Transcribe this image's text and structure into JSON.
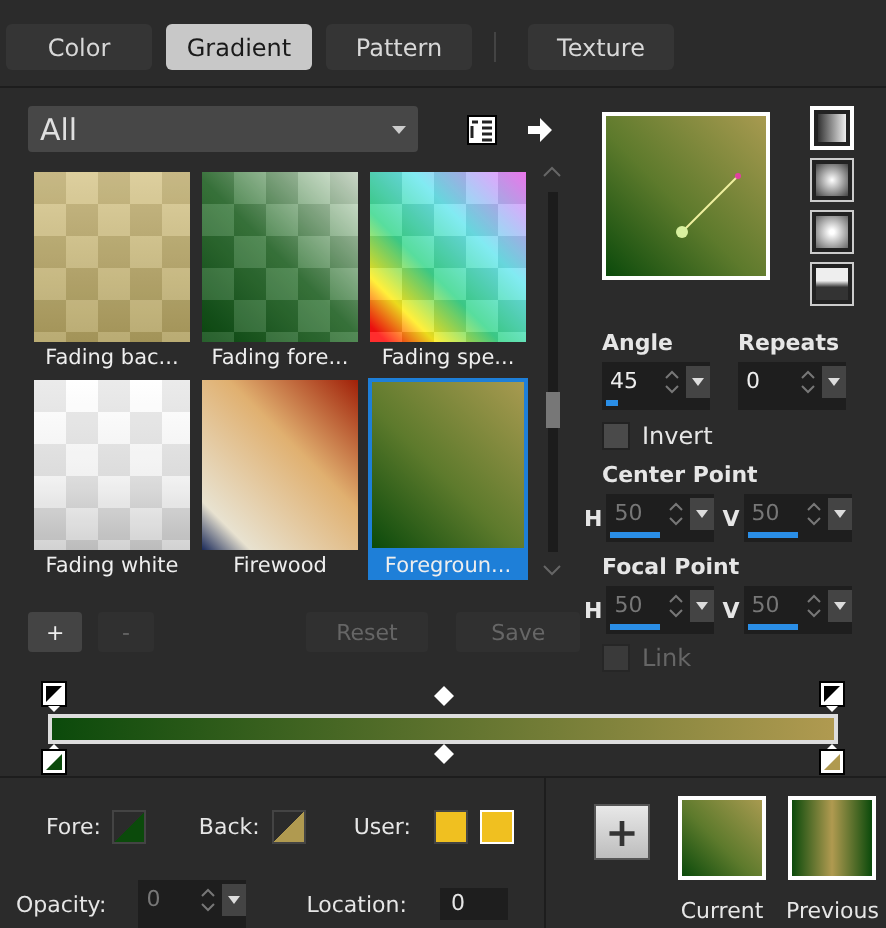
{
  "tabs": [
    {
      "label": "Color",
      "selected": false
    },
    {
      "label": "Gradient",
      "selected": true
    },
    {
      "label": "Pattern",
      "selected": false
    },
    {
      "label": "Texture",
      "selected": false
    }
  ],
  "category": {
    "value": "All"
  },
  "gradients": [
    {
      "label": "Fading bac...",
      "selected": false
    },
    {
      "label": "Fading fore...",
      "selected": false
    },
    {
      "label": "Fading spe...",
      "selected": false
    },
    {
      "label": "Fading white",
      "selected": false
    },
    {
      "label": "Firewood",
      "selected": false
    },
    {
      "label": "Foregroun...",
      "selected": true
    }
  ],
  "styles": [
    {
      "kind": "linear",
      "selected": true
    },
    {
      "kind": "rectangular",
      "selected": false
    },
    {
      "kind": "sunburst",
      "selected": false
    },
    {
      "kind": "radial",
      "selected": false
    }
  ],
  "angle": {
    "label": "Angle",
    "value": "45",
    "level": 0.125
  },
  "repeats": {
    "label": "Repeats",
    "value": "0"
  },
  "invert": {
    "label": "Invert",
    "checked": false
  },
  "center_point": {
    "label": "Center Point",
    "h": {
      "label": "H",
      "value": "50",
      "level": 0.5
    },
    "v": {
      "label": "V",
      "value": "50",
      "level": 0.5
    },
    "disabled": true
  },
  "focal_point": {
    "label": "Focal Point",
    "h": {
      "label": "H",
      "value": "50",
      "level": 0.5
    },
    "v": {
      "label": "V",
      "value": "50",
      "level": 0.5
    },
    "disabled": true
  },
  "link": {
    "label": "Link",
    "checked": false,
    "disabled": true
  },
  "buttons": [
    {
      "label": "+",
      "disabled": false
    },
    {
      "label": "-",
      "disabled": true
    },
    {
      "label": "Reset",
      "disabled": true
    },
    {
      "label": "Save",
      "disabled": true
    }
  ],
  "fore": {
    "label": "Fore:",
    "color": "#0b4a0b"
  },
  "back": {
    "label": "Back:",
    "color": "#b09a50"
  },
  "user": {
    "label": "User:",
    "swatches": [
      {
        "color": "#f0c020"
      },
      {
        "color": "#f0c020"
      }
    ]
  },
  "opacity": {
    "label": "Opacity:",
    "value": "0",
    "disabled": true
  },
  "location": {
    "label": "Location:",
    "value": "0"
  },
  "add_button": {
    "label": "+"
  },
  "current": {
    "label": "Current"
  },
  "previous": {
    "label": "Previous"
  }
}
